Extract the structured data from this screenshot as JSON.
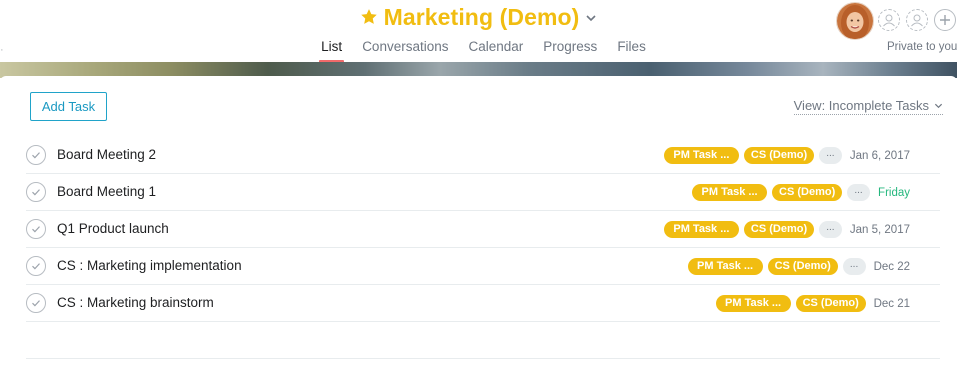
{
  "project": {
    "title": "Marketing (Demo)",
    "favorite_icon": "star-icon",
    "title_color": "#f1bd11"
  },
  "nav": {
    "tabs": [
      {
        "label": "List",
        "active": true
      },
      {
        "label": "Conversations",
        "active": false
      },
      {
        "label": "Calendar",
        "active": false
      },
      {
        "label": "Progress",
        "active": false
      },
      {
        "label": "Files",
        "active": false
      }
    ]
  },
  "members": {
    "privacy": "Private to you",
    "add_icon": "plus-icon"
  },
  "toolbar": {
    "add_task_label": "Add Task",
    "view_label": "View: Incomplete Tasks"
  },
  "tasks": [
    {
      "name": "Board Meeting 2",
      "tags": [
        "PM Task ...",
        "CS (Demo)"
      ],
      "more": "...",
      "due": "Jan 6, 2017"
    },
    {
      "name": "Board Meeting 1",
      "tags": [
        "PM Task ...",
        "CS (Demo)"
      ],
      "more": "...",
      "due": "Friday",
      "due_color": "#25b77e"
    },
    {
      "name": "Q1 Product launch",
      "tags": [
        "PM Task ...",
        "CS (Demo)"
      ],
      "more": "...",
      "due": "Jan 5, 2017"
    },
    {
      "name": "CS : Marketing implementation",
      "tags": [
        "PM Task ...",
        "CS (Demo)"
      ],
      "more": "...",
      "due": "Dec 22"
    },
    {
      "name": "CS : Marketing brainstorm",
      "tags": [
        "PM Task ...",
        "CS (Demo)"
      ],
      "due": "Dec 21"
    }
  ],
  "colors": {
    "tag": "#f1bd11",
    "active_tab_underline": "#f06a6a",
    "add_task_border": "#20a3c9"
  }
}
